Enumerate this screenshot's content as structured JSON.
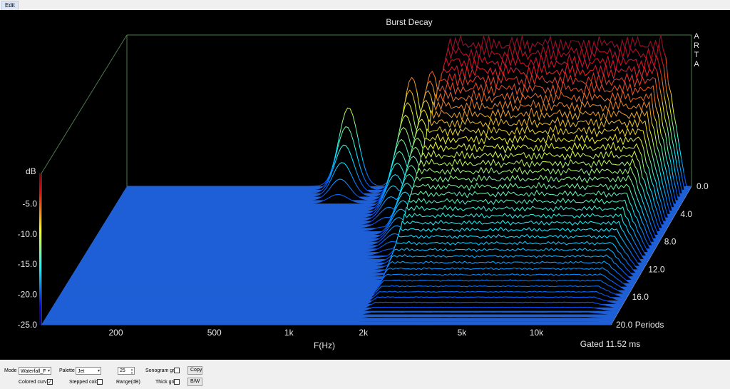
{
  "menu": {
    "edit_label": "Edit"
  },
  "chart_data": {
    "type": "waterfall",
    "title": "Burst Decay",
    "watermark": "ARTA",
    "xlabel": "F(Hz)",
    "x_scale": "log",
    "xlim": [
      100,
      20000
    ],
    "x_ticks": [
      {
        "value": 200,
        "label": "200"
      },
      {
        "value": 500,
        "label": "500"
      },
      {
        "value": 1000,
        "label": "1k"
      },
      {
        "value": 2000,
        "label": "2k"
      },
      {
        "value": 5000,
        "label": "5k"
      },
      {
        "value": 10000,
        "label": "10k"
      }
    ],
    "zlabel": "dB",
    "zlim": [
      -25,
      0
    ],
    "z_ticks": [
      "-5.0",
      "-10.0",
      "-15.0",
      "-20.0",
      "-25.0"
    ],
    "depth_label": "Periods",
    "depth_ticks": [
      "0.0",
      "4.0",
      "8.0",
      "12.0",
      "16.0",
      "20.0 Periods"
    ],
    "depth_range": [
      0,
      20
    ],
    "gated_text": "Gated 11.52 ms",
    "palette": "Jet",
    "colors": {
      "low": "#1f5fd6",
      "mid": "#00e5ff",
      "high": "#ff2200",
      "background": "#000000"
    },
    "floor_db": -25,
    "slices": 40,
    "main_response": {
      "f_range_hz": [
        1850,
        19000
      ],
      "level_db_at_0_periods": -1.5,
      "decay_to_floor_periods": 20
    },
    "resonance_peaks": [
      {
        "freq_hz": 800,
        "level_db": -12,
        "decay_periods": 3
      },
      {
        "freq_hz": 1450,
        "level_db": -7,
        "decay_periods": 7
      },
      {
        "freq_hz": 1750,
        "level_db": -6,
        "decay_periods": 11
      },
      {
        "freq_hz": 2050,
        "level_db": -9,
        "decay_periods": 14
      },
      {
        "freq_hz": 2750,
        "level_db": -11,
        "decay_periods": 13
      },
      {
        "freq_hz": 3500,
        "level_db": -18,
        "decay_periods": 20
      }
    ]
  },
  "controls": {
    "mode_label": "Mode",
    "mode_value": "Waterfall_F",
    "palette_label": "Palette",
    "palette_value": "Jet",
    "range_value": "25",
    "range_label": "Range(dB)",
    "sonogram_grid_label": "Sonogram grid",
    "sonogram_grid_checked": false,
    "copy_label": "Copy",
    "colored_curves_label": "Colored curves",
    "colored_curves_checked": true,
    "stepped_colors_label": "Stepped colors",
    "stepped_colors_checked": false,
    "thick_grid_label": "Thick grid",
    "thick_grid_checked": false,
    "bw_label": "B/W"
  }
}
